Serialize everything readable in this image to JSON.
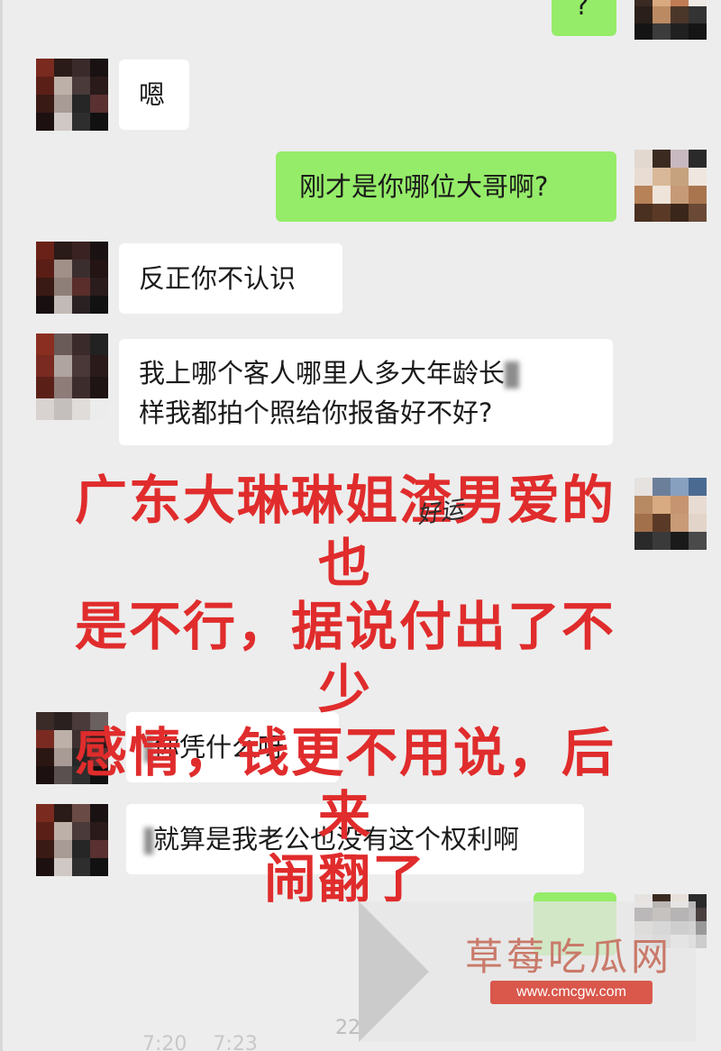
{
  "messages": [
    {
      "side": "out",
      "text": "?"
    },
    {
      "side": "in",
      "text": "嗯"
    },
    {
      "side": "out",
      "text": "刚才是你哪位大哥啊?"
    },
    {
      "side": "in",
      "text": "反正你不认识"
    },
    {
      "side": "in",
      "line1": "我上哪个客人哪里人多大年龄长",
      "line2": "样我都拍个照给你报备好不好?"
    },
    {
      "side": "in",
      "text": "你凭什么呀"
    },
    {
      "side": "in",
      "text": "就算是我老公也没有这个权利啊"
    }
  ],
  "overlay": {
    "line1": "广东大琳琳姐渣男爱的也",
    "line2": "是不行，据说付出了不少",
    "line3": "感情，钱更不用说，后来",
    "line4": "闹翻了"
  },
  "scribble": "好运",
  "timestamps": [
    "7:20",
    "7:23"
  ],
  "small_time": "22",
  "watermark": {
    "logo_text": "草莓吃瓜网",
    "url": "www.cmcgw.com"
  },
  "colors": {
    "background": "#ededed",
    "incoming_bubble": "#ffffff",
    "outgoing_bubble": "#95ec69",
    "overlay_text": "#e02c2c",
    "watermark_badge": "#d9574b"
  }
}
